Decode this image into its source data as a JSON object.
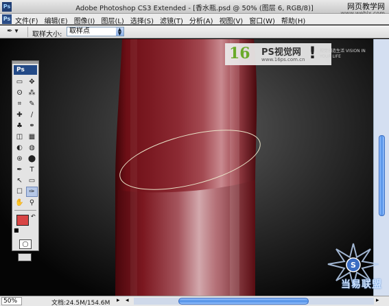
{
  "window": {
    "app_icon": "Ps",
    "title": "Adobe Photoshop CS3 Extended - [香水瓶.psd @ 50% (图层 6, RGB/8)]",
    "watermark_site": "网页教学网",
    "watermark_url": "www.webjx.com"
  },
  "menu": {
    "ps_icon": "Ps",
    "items": [
      "文件(F)",
      "编辑(E)",
      "图像(I)",
      "图层(L)",
      "选择(S)",
      "滤镜(T)",
      "分析(A)",
      "视图(V)",
      "窗口(W)",
      "帮助(H)"
    ]
  },
  "options": {
    "tool_icon": "eyedropper-icon",
    "sample_label": "取样大小:",
    "sample_value": "取样点"
  },
  "canvas_watermark": {
    "logo_num": "16",
    "title": "PS视觉网",
    "url": "www.16ps.com.cn",
    "mark": "!",
    "tagline": "视觉创造生活 VISION IN YOUR LIFE"
  },
  "tools": {
    "header": "Ps",
    "items": [
      "▭",
      "✥",
      "ʘ",
      "⁂",
      "⌗",
      "✎",
      "✚",
      "∕",
      "♣",
      "⚭",
      "◫",
      "▦",
      "◐",
      "◍",
      "⊛",
      "⬤",
      "✒",
      "T",
      "↖",
      "▭",
      "☐",
      "✑",
      "✋",
      "⚲"
    ],
    "selected_index": 21,
    "foreground_color": "#d84545",
    "background_color": "#111111"
  },
  "status": {
    "zoom": "50%",
    "doc_info": "文档:24.5M/154.6M"
  },
  "badge": {
    "text": "当易联盟"
  }
}
